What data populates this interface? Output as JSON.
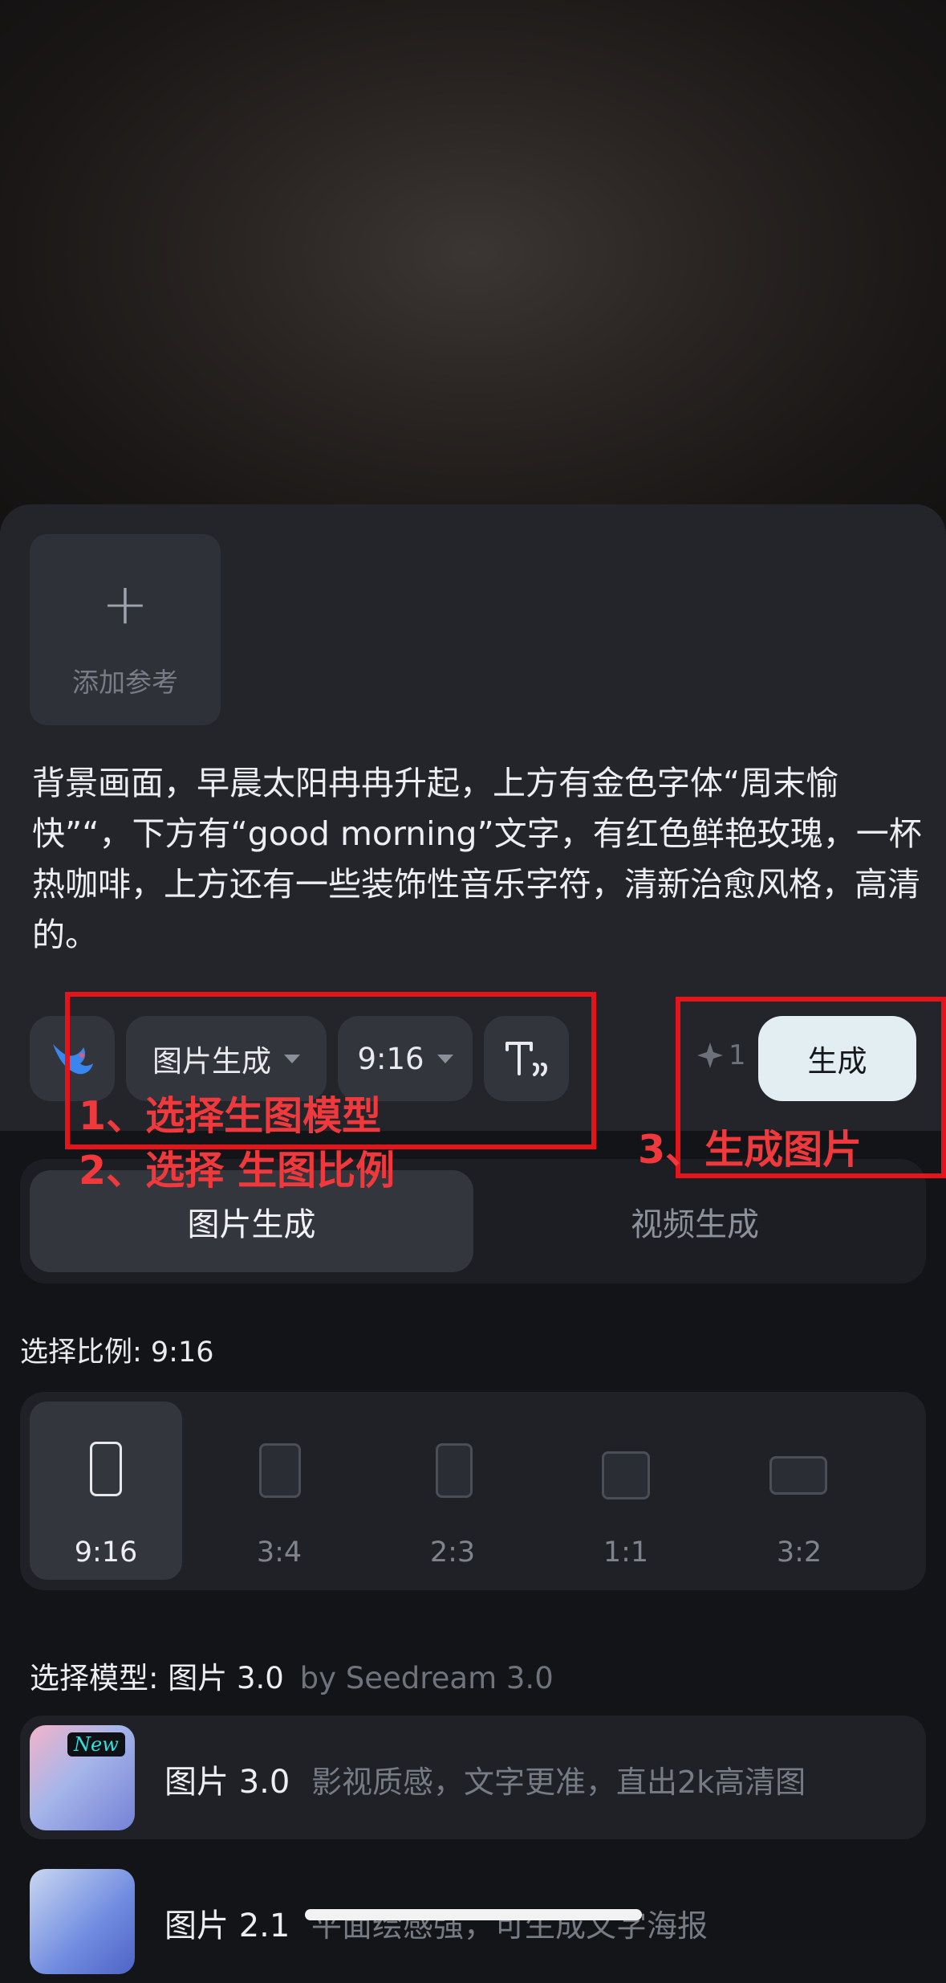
{
  "reference": {
    "plus": "+",
    "label": "添加参考"
  },
  "prompt": "背景画面，早晨太阳冉冉升起，上方有金色字体“周末愉快”“，下方有“good morning”文字，有红色鲜艳玫瑰，一杯热咖啡，上方还有一些装饰性音乐字符，清新治愈风格，高清的。",
  "toolbar": {
    "mode_label": "图片生成",
    "ratio_label": "9:16",
    "credits": "1",
    "generate_label": "生成"
  },
  "tabs": {
    "image": "图片生成",
    "video": "视频生成"
  },
  "ratio_section": {
    "title": "选择比例: 9:16",
    "options": [
      "9:16",
      "3:4",
      "2:3",
      "1:1",
      "3:2"
    ],
    "selected": "9:16"
  },
  "model_section": {
    "title": "选择模型: 图片 3.0",
    "by": "by Seedream 3.0",
    "models": [
      {
        "name": "图片 3.0",
        "desc": "影视质感，文字更准，直出2k高清图",
        "badge": "New"
      },
      {
        "name": "图片 2.1",
        "desc": "平面绘感强，可生成文字海报"
      }
    ]
  },
  "annotations": {
    "step1": "1、选择生图模型",
    "step2": "2、选择 生图比例",
    "step3": "3、生成图片"
  },
  "colors": {
    "annotation": "#e5141a",
    "generate_button": "#e3eef2",
    "new_badge_text": "#2de3e3"
  }
}
